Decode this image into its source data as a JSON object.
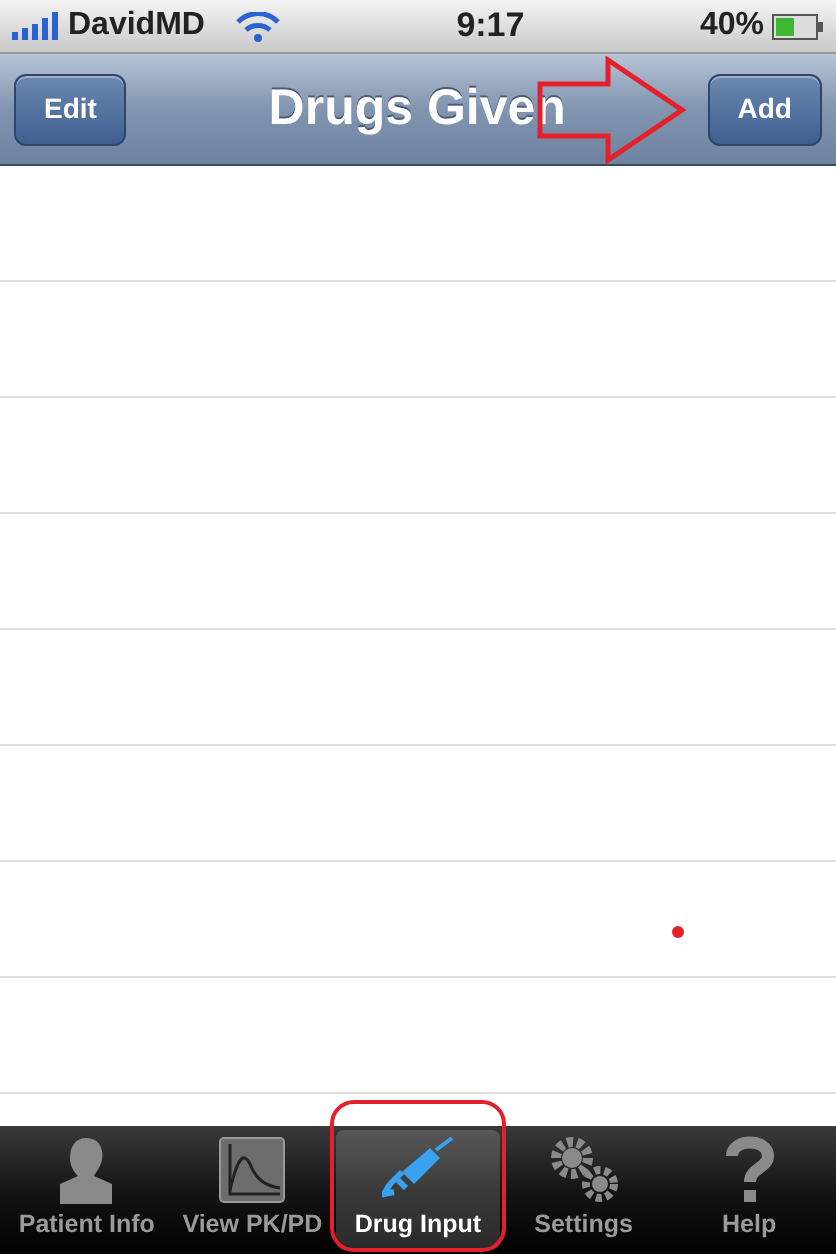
{
  "status_bar": {
    "carrier": "DavidMD",
    "time": "9:17",
    "battery": "40%"
  },
  "nav_bar": {
    "title": "Drugs Given",
    "left_button": "Edit",
    "right_button": "Add"
  },
  "tabs": [
    {
      "label": "Patient Info",
      "kind": "person",
      "selected": false
    },
    {
      "label": "View PK/PD",
      "kind": "chart",
      "selected": false
    },
    {
      "label": "Drug Input",
      "kind": "syringe",
      "selected": true
    },
    {
      "label": "Settings",
      "kind": "gears",
      "selected": false
    },
    {
      "label": "Help",
      "kind": "help",
      "selected": false
    }
  ]
}
